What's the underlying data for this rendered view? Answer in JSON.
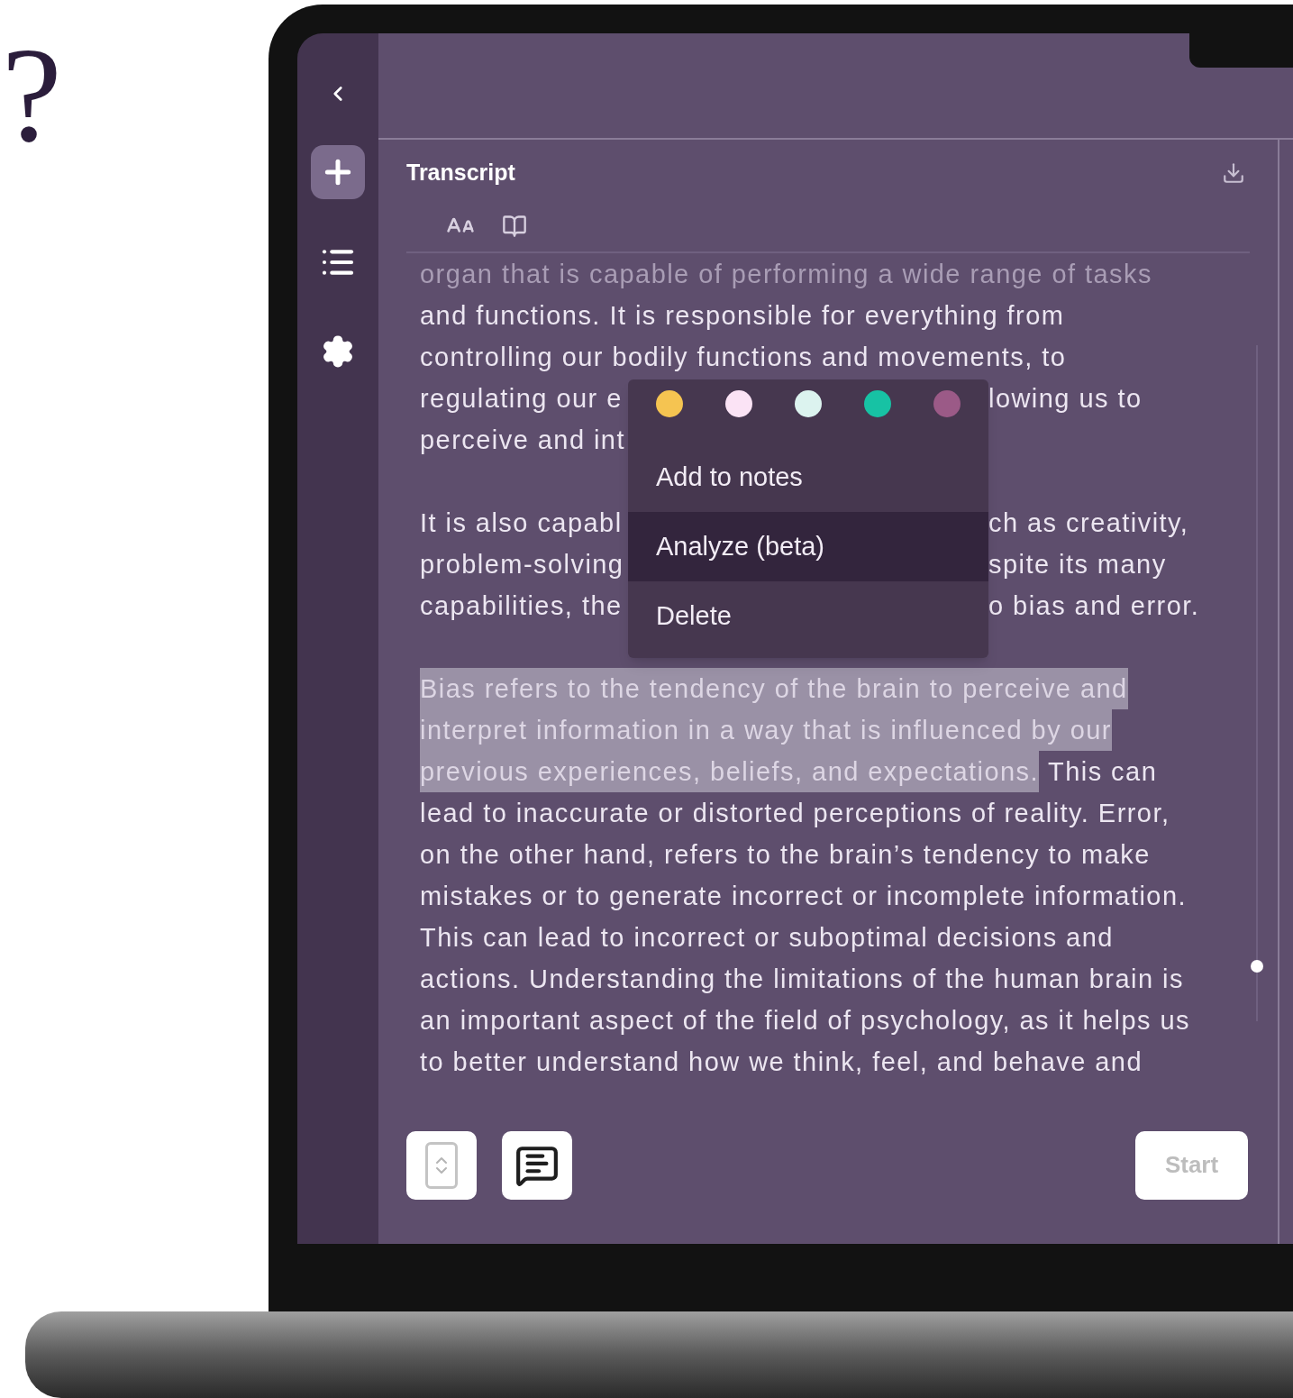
{
  "decoration": {
    "mark": "?"
  },
  "panel": {
    "title": "Transcript"
  },
  "transcript": {
    "faded_line": "organ that is capable of performing a wide range of tasks",
    "paragraphs": [
      {
        "lines": [
          {
            "segments": [
              {
                "kind": "plain",
                "text": "and functions. It is responsible for everything from"
              }
            ]
          },
          {
            "segments": [
              {
                "kind": "plain",
                "text": "controlling our bodily functions and movements, to"
              }
            ]
          },
          {
            "segments": [
              {
                "kind": "left_of_menu",
                "text": "regulating our e"
              },
              {
                "kind": "right_of_menu",
                "text": "lowing us to"
              }
            ]
          },
          {
            "segments": [
              {
                "kind": "left_of_menu",
                "text": "perceive and int"
              }
            ]
          }
        ]
      },
      {
        "lines": [
          {
            "segments": [
              {
                "kind": "left_of_menu",
                "text": "It is also capabl"
              },
              {
                "kind": "right_of_menu",
                "text": "ch as creativity,"
              }
            ]
          },
          {
            "segments": [
              {
                "kind": "left_of_menu",
                "text": "problem-solving"
              },
              {
                "kind": "right_of_menu",
                "text": "spite its many"
              }
            ]
          },
          {
            "segments": [
              {
                "kind": "left_of_menu",
                "text": "capabilities, the"
              },
              {
                "kind": "right_of_menu",
                "text": "o bias and error."
              }
            ]
          }
        ]
      },
      {
        "lines": [
          {
            "segments": [
              {
                "kind": "highlighted",
                "text": "Bias refers to the tendency of the brain to perceive and"
              }
            ]
          },
          {
            "segments": [
              {
                "kind": "highlighted",
                "text": "interpret information in a way that is influenced by our"
              }
            ]
          },
          {
            "segments": [
              {
                "kind": "highlighted",
                "text": "previous experiences, beliefs, and expectations."
              },
              {
                "kind": "plain",
                "text": "This can"
              }
            ]
          },
          {
            "segments": [
              {
                "kind": "plain",
                "text": "lead to inaccurate or distorted perceptions of reality. Error,"
              }
            ]
          },
          {
            "segments": [
              {
                "kind": "plain",
                "text": "on the other hand, refers to the brain’s tendency to make"
              }
            ]
          },
          {
            "segments": [
              {
                "kind": "plain",
                "text": "mistakes or to generate incorrect or incomplete information."
              }
            ]
          },
          {
            "segments": [
              {
                "kind": "plain",
                "text": "This can lead to incorrect or suboptimal decisions and"
              }
            ]
          },
          {
            "segments": [
              {
                "kind": "plain",
                "text": "actions. Understanding the limitations of the human brain is"
              }
            ]
          },
          {
            "segments": [
              {
                "kind": "plain",
                "text": "an important aspect of the field of psychology, as it helps us"
              }
            ]
          },
          {
            "segments": [
              {
                "kind": "plain",
                "text": "to better understand how we think, feel, and behave and"
              }
            ]
          }
        ]
      }
    ]
  },
  "context_menu": {
    "colors": [
      {
        "color": "#f5c451"
      },
      {
        "color": "#fbe3f5"
      },
      {
        "color": "#dcf3ef"
      },
      {
        "color": "#17c2a4"
      },
      {
        "color": "#9b5a87"
      }
    ],
    "items": [
      {
        "label": "Add to notes",
        "selected": false
      },
      {
        "label": "Analyze (beta)",
        "selected": true
      },
      {
        "label": "Delete",
        "selected": false
      }
    ]
  },
  "start_button": {
    "label": "Start",
    "disabled": true
  }
}
